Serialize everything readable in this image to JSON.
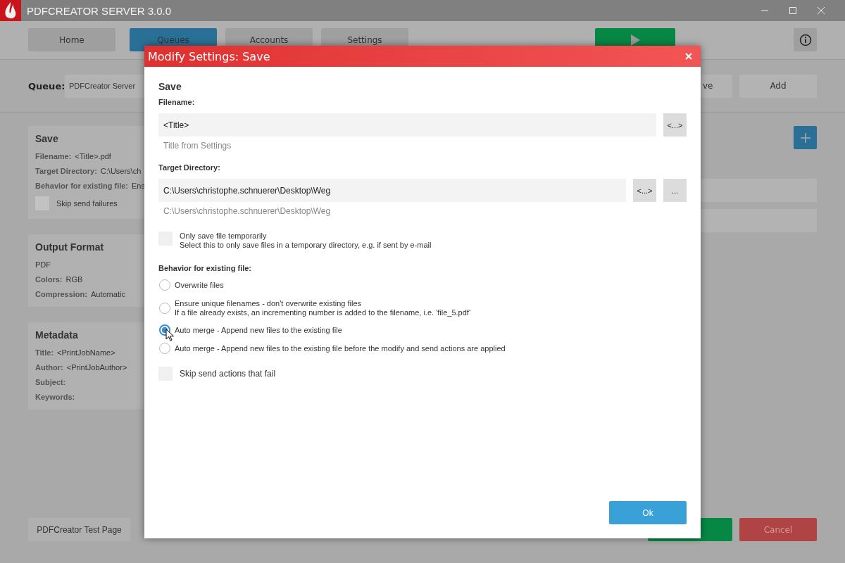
{
  "window": {
    "title": "PDFCREATOR SERVER 3.0.0"
  },
  "nav": {
    "tabs": [
      {
        "label": "Home",
        "selected": false
      },
      {
        "label": "Queues",
        "selected": true
      },
      {
        "label": "Accounts",
        "selected": false
      },
      {
        "label": "Settings",
        "selected": false
      }
    ]
  },
  "queue": {
    "label": "Queue:",
    "value": "PDFCreator Server",
    "buttons": [
      "ve",
      "Add"
    ]
  },
  "cards": [
    {
      "title": "Save",
      "rows": [
        {
          "label": "Filename:",
          "value": "<Title>.pdf"
        },
        {
          "label": "Target Directory:",
          "value": "C:\\Users\\ch"
        },
        {
          "label": "Behavior for existing file:",
          "value": "Ens"
        }
      ],
      "checkbox": {
        "label": "Skip send failures",
        "checked": false
      }
    },
    {
      "title": "Output Format",
      "rows": [
        {
          "value": "PDF"
        },
        {
          "label": "Colors:",
          "value": "RGB"
        },
        {
          "label": "Compression:",
          "value": "Automatic"
        }
      ]
    },
    {
      "title": "Metadata",
      "rows": [
        {
          "label": "Title:",
          "value": "<PrintJobName>"
        },
        {
          "label": "Author:",
          "value": "<PrintJobAuthor>"
        },
        {
          "label": "Subject:"
        },
        {
          "label": "Keywords:"
        }
      ]
    }
  ],
  "footer": {
    "test_page_button": "PDFCreator Test Page",
    "cancel_button": "Cancel"
  },
  "dialog": {
    "title": "Modify Settings: Save",
    "heading": "Save",
    "filename": {
      "label": "Filename:",
      "value": "<Title>",
      "token_button": "<...>",
      "hint": "Title from Settings"
    },
    "target": {
      "label": "Target Directory:",
      "value": "C:\\Users\\christophe.schnuerer\\Desktop\\Weg",
      "token_button": "<...>",
      "browse_button": "...",
      "hint": "C:\\Users\\christophe.schnuerer\\Desktop\\Weg"
    },
    "temp_checkbox": {
      "checked": false,
      "label": "Only save file temporarily",
      "description": "Select this to only save files in a temporary directory, e.g. if sent by e-mail"
    },
    "behavior": {
      "label": "Behavior for existing file:",
      "options": [
        {
          "label": "Overwrite files",
          "selected": false
        },
        {
          "label": "Ensure unique filenames - don't overwrite existing files",
          "description": "If a file already exists, an incrementing number is added to the filename, i.e. 'file_5.pdf'",
          "selected": false
        },
        {
          "label": "Auto merge - Append new files to the existing file",
          "selected": true
        },
        {
          "label": "Auto merge - Append new files to the existing file before the modify and send actions are applied",
          "selected": false
        }
      ]
    },
    "skip_checkbox": {
      "checked": false,
      "label": "Skip send actions that fail"
    },
    "ok_button": "Ok"
  }
}
